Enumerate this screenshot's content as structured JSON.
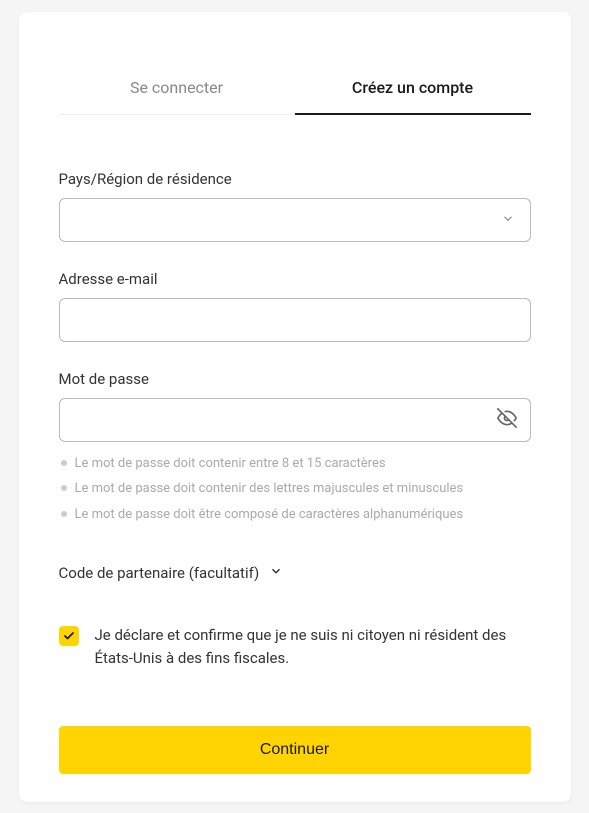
{
  "tabs": {
    "signin": "Se connecter",
    "signup": "Créez un compte"
  },
  "form": {
    "country_label": "Pays/Région de résidence",
    "country_value": "",
    "email_label": "Adresse e-mail",
    "email_value": "",
    "password_label": "Mot de passe",
    "password_value": "",
    "hints": {
      "h1": "Le mot de passe doit contenir entre 8 et 15 caractères",
      "h2": "Le mot de passe doit contenir des lettres majuscules et minuscules",
      "h3": "Le mot de passe doit être composé de caractères alphanumériques"
    },
    "partner_label": "Code de partenaire (facultatif)",
    "declaration": "Je déclare et confirme que je ne suis ni citoyen ni résident des États-Unis à des fins fiscales.",
    "submit_label": "Continuer"
  }
}
